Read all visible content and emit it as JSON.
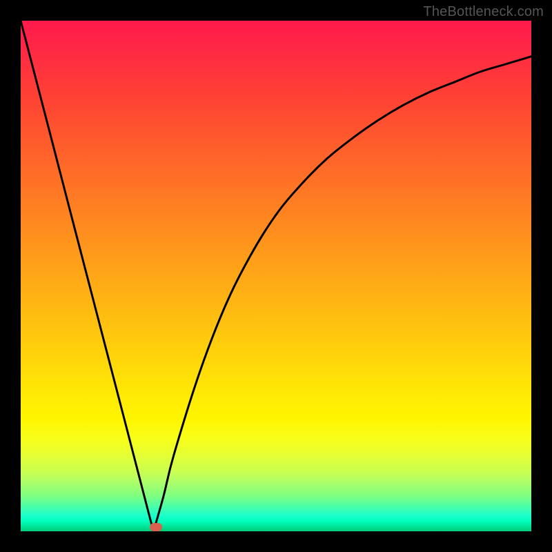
{
  "attribution": "TheBottleneck.com",
  "colors": {
    "frame": "#000000",
    "curve": "#000000",
    "marker": "#d9604f"
  },
  "chart_data": {
    "type": "line",
    "title": "",
    "xlabel": "",
    "ylabel": "",
    "xlim": [
      0,
      100
    ],
    "ylim": [
      0,
      100
    ],
    "grid": false,
    "legend": false,
    "series": [
      {
        "name": "left-arm",
        "x": [
          0,
          5,
          10,
          15,
          20,
          25,
          26
        ],
        "values": [
          100,
          80.8,
          61.5,
          42.3,
          23.1,
          3.8,
          0
        ]
      },
      {
        "name": "right-arm",
        "x": [
          26,
          28,
          30,
          35,
          40,
          45,
          50,
          55,
          60,
          65,
          70,
          75,
          80,
          85,
          90,
          95,
          100
        ],
        "values": [
          0,
          7,
          15,
          31,
          44,
          54,
          62,
          68,
          73,
          77,
          80.5,
          83.5,
          86,
          88,
          90,
          91.5,
          93
        ]
      }
    ],
    "annotations": [
      {
        "name": "trough-marker",
        "x": 26.5,
        "y": 0.8
      }
    ]
  }
}
